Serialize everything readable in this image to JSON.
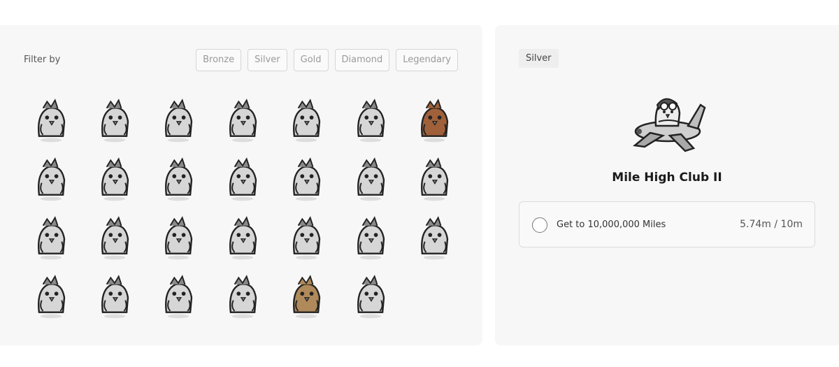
{
  "filter": {
    "label": "Filter by",
    "options": [
      "Bronze",
      "Silver",
      "Gold",
      "Diamond",
      "Legendary"
    ]
  },
  "badges": [
    {
      "name": "egg-bird-icon"
    },
    {
      "name": "blanket-bird-icon"
    },
    {
      "name": "plaid-bird-icon"
    },
    {
      "name": "suit-bird-icon"
    },
    {
      "name": "beret-bird-icon"
    },
    {
      "name": "headphones-bird-icon"
    },
    {
      "name": "pilot-bird-icon",
      "color": "#a0603a"
    },
    {
      "name": "plane-bird-icon"
    },
    {
      "name": "plane-bird-icon"
    },
    {
      "name": "jet-bird-icon"
    },
    {
      "name": "dark-jet-bird-icon"
    },
    {
      "name": "beanie-bird-icon"
    },
    {
      "name": "beanie-glasses-bird-icon"
    },
    {
      "name": "hooded-dark-bird-icon"
    },
    {
      "name": "hooded-bird-icon"
    },
    {
      "name": "two-birds-icon"
    },
    {
      "name": "three-birds-icon"
    },
    {
      "name": "four-birds-icon"
    },
    {
      "name": "five-birds-icon"
    },
    {
      "name": "flock-birds-icon"
    },
    {
      "name": "winged-bird-icon"
    },
    {
      "name": "butterfly-bird-icon"
    },
    {
      "name": "butterfly-bird-dark-icon"
    },
    {
      "name": "heart-bird-icon"
    },
    {
      "name": "heart-bird-light-icon"
    },
    {
      "name": "honey-bird-icon",
      "color": "#b08a5a"
    },
    {
      "name": "jar-bird-icon"
    }
  ],
  "detail": {
    "tier": "Silver",
    "title": "Mile High Club II",
    "task": "Get to 10,000,000 Miles",
    "progress": "5.74m / 10m",
    "icon": "plane-bird-icon"
  }
}
